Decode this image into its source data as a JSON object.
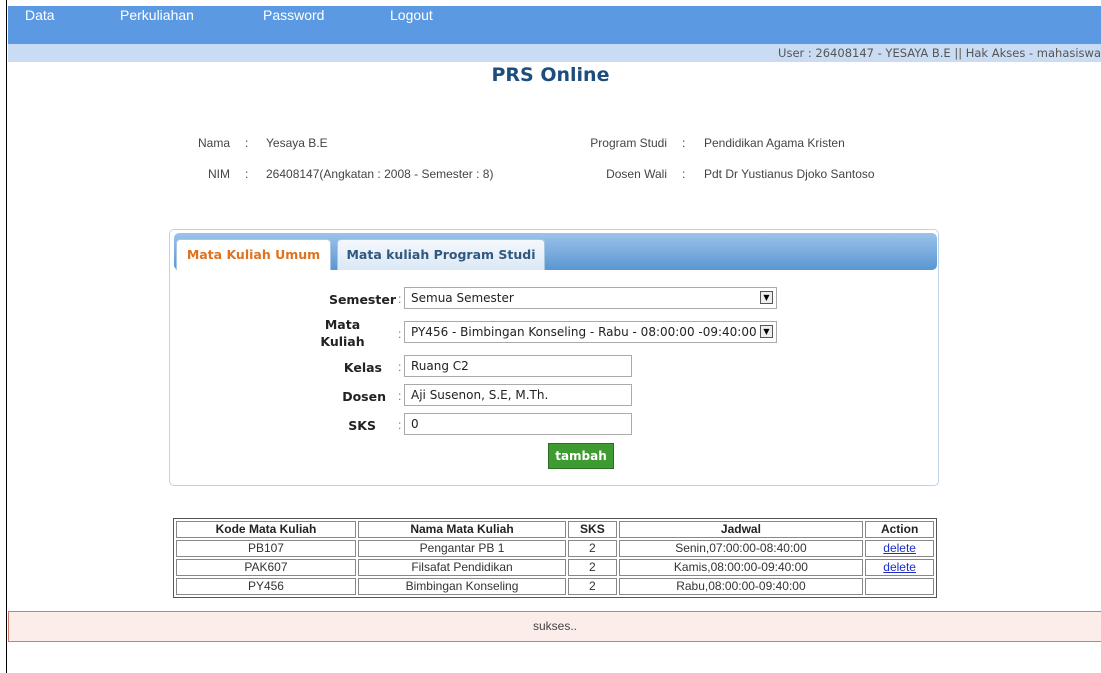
{
  "nav": {
    "items": [
      "Data",
      "Perkuliahan",
      "Password",
      "Logout"
    ]
  },
  "userbar": {
    "text": "User : 26408147 - YESAYA B.E || Hak Akses - mahasiswa"
  },
  "page": {
    "title": "PRS Online"
  },
  "student": {
    "name_label": "Nama",
    "name": "Yesaya B.E",
    "nim_label": "NIM",
    "nim": "26408147(Angkatan : 2008 - Semester : 8)",
    "prodi_label": "Program Studi",
    "prodi": "Pendidikan Agama Kristen",
    "wali_label": "Dosen Wali",
    "wali": "Pdt Dr Yustianus Djoko Santoso"
  },
  "tabs": [
    "Mata Kuliah Umum",
    "Mata kuliah Program Studi"
  ],
  "form": {
    "semester_label": "Semester",
    "semester_value": "Semua Semester",
    "matkul_label_1": "Mata",
    "matkul_label_2": "Kuliah",
    "matkul_value": "PY456 - Bimbingan Konseling - Rabu - 08:00:00 -09:40:00",
    "kelas_label": "Kelas",
    "kelas_value": "Ruang C2",
    "dosen_label": "Dosen",
    "dosen_value": "Aji Susenon, S.E, M.Th.",
    "sks_label": "SKS",
    "sks_value": "0",
    "submit_label": "tambah"
  },
  "table": {
    "headers": [
      "Kode Mata Kuliah",
      "Nama Mata Kuliah",
      "SKS",
      "Jadwal",
      "Action"
    ],
    "rows": [
      {
        "kode": "PB107",
        "nama": "Pengantar PB 1",
        "sks": "2",
        "jadwal": "Senin,07:00:00-08:40:00",
        "action": "delete"
      },
      {
        "kode": "PAK607",
        "nama": "Filsafat Pendidikan",
        "sks": "2",
        "jadwal": "Kamis,08:00:00-09:40:00",
        "action": "delete"
      },
      {
        "kode": "PY456",
        "nama": "Bimbingan Konseling",
        "sks": "2",
        "jadwal": "Rabu,08:00:00-09:40:00",
        "action": ""
      }
    ]
  },
  "status": {
    "message": "sukses.."
  },
  "colors": {
    "nav_bg": "#5b9ae3",
    "accent_tab": "#e0721f",
    "button_bg": "#3d9b32",
    "status_bg": "#fcecea"
  },
  "icons": [
    "dropdown-arrow-icon"
  ]
}
